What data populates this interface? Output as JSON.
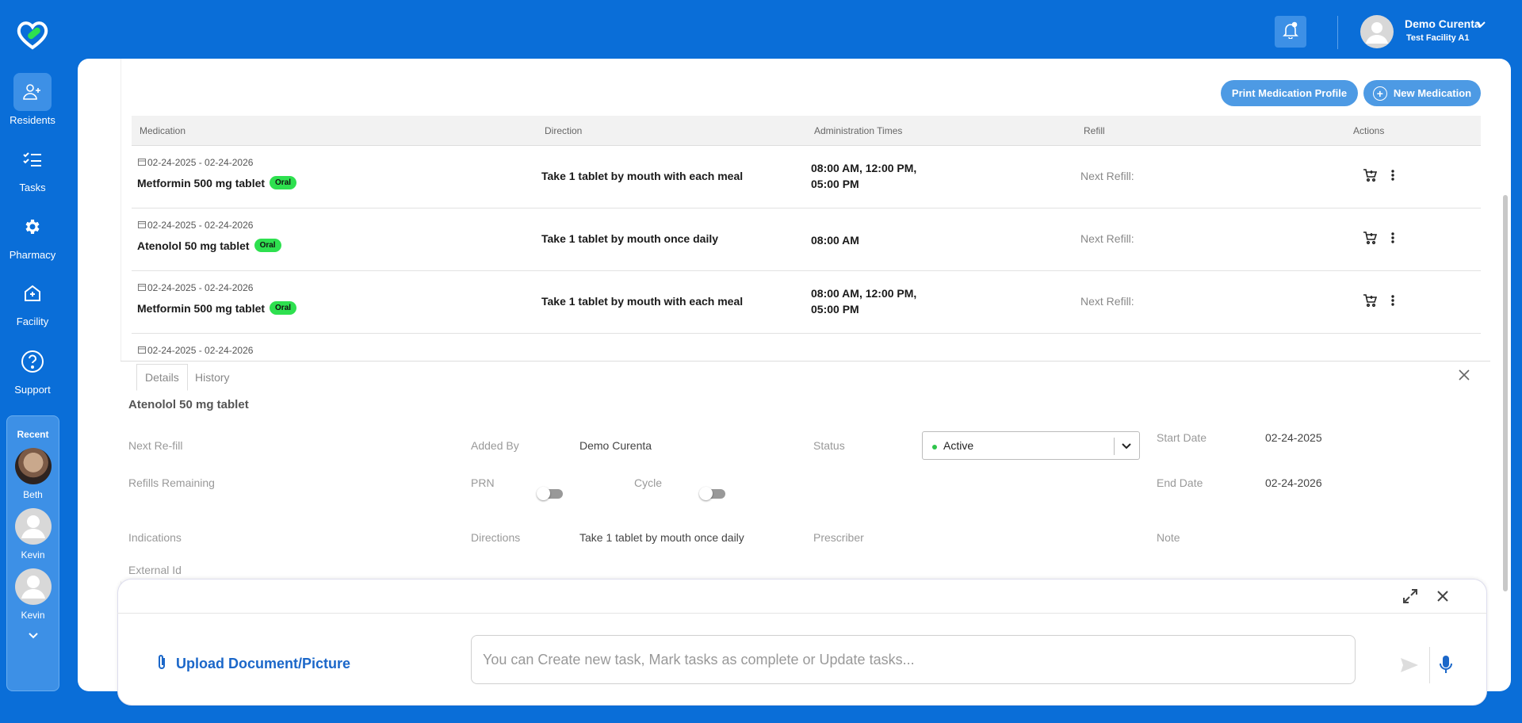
{
  "nav": {
    "items": [
      {
        "label": "Residents",
        "icon": "residents-icon"
      },
      {
        "label": "Tasks",
        "icon": "tasks-icon"
      },
      {
        "label": "Pharmacy",
        "icon": "gear-icon"
      },
      {
        "label": "Facility",
        "icon": "facility-icon"
      },
      {
        "label": "Support",
        "icon": "help-icon"
      }
    ],
    "recent": {
      "title": "Recent",
      "people": [
        "Beth",
        "Kevin",
        "Kevin"
      ]
    }
  },
  "header": {
    "user_name": "Demo Curenta",
    "facility": "Test Facility A1"
  },
  "toolbar": {
    "print_label": "Print Medication Profile",
    "new_label": "New Medication"
  },
  "table": {
    "columns": [
      "Medication",
      "Direction",
      "Administration Times",
      "Refill",
      "Actions"
    ],
    "rows": [
      {
        "dates": "02-24-2025 - 02-24-2026",
        "name": "Metformin 500 mg tablet",
        "route": "Oral",
        "direction": "Take 1 tablet by mouth with each meal",
        "times_line1": "08:00 AM, 12:00 PM,",
        "times_line2": "05:00 PM",
        "refill": "Next Refill:"
      },
      {
        "dates": "02-24-2025 - 02-24-2026",
        "name": "Atenolol 50 mg tablet",
        "route": "Oral",
        "direction": "Take 1 tablet by mouth once daily",
        "times_line1": "08:00 AM",
        "times_line2": "",
        "refill": "Next Refill:"
      },
      {
        "dates": "02-24-2025 - 02-24-2026",
        "name": "Metformin 500 mg tablet",
        "route": "Oral",
        "direction": "Take 1 tablet by mouth with each meal",
        "times_line1": "08:00 AM, 12:00 PM,",
        "times_line2": "05:00 PM",
        "refill": "Next Refill:"
      },
      {
        "dates": "02-24-2025 - 02-24-2026"
      }
    ]
  },
  "details": {
    "tabs": [
      "Details",
      "History"
    ],
    "title": "Atenolol 50 mg tablet",
    "labels": {
      "next_refill": "Next Re-fill",
      "added_by": "Added By",
      "status": "Status",
      "start_date": "Start Date",
      "refills_remaining": "Refills Remaining",
      "prn": "PRN",
      "cycle": "Cycle",
      "end_date": "End Date",
      "indications": "Indications",
      "directions": "Directions",
      "prescriber": "Prescriber",
      "note": "Note",
      "external_id": "External Id"
    },
    "values": {
      "added_by": "Demo Curenta",
      "status": "Active",
      "start_date": "02-24-2025",
      "end_date": "02-24-2026",
      "directions": "Take 1 tablet by mouth once daily"
    },
    "prn_on": false,
    "cycle_on": false
  },
  "assistant": {
    "upload_label": "Upload Document/Picture",
    "placeholder": "You can Create new task, Mark tasks as complete or Update tasks..."
  },
  "colors": {
    "brand": "#0a6ed8",
    "accent": "#4d9ae4",
    "route_badge": "#2ee04f",
    "status_active": "#2ec44b"
  }
}
